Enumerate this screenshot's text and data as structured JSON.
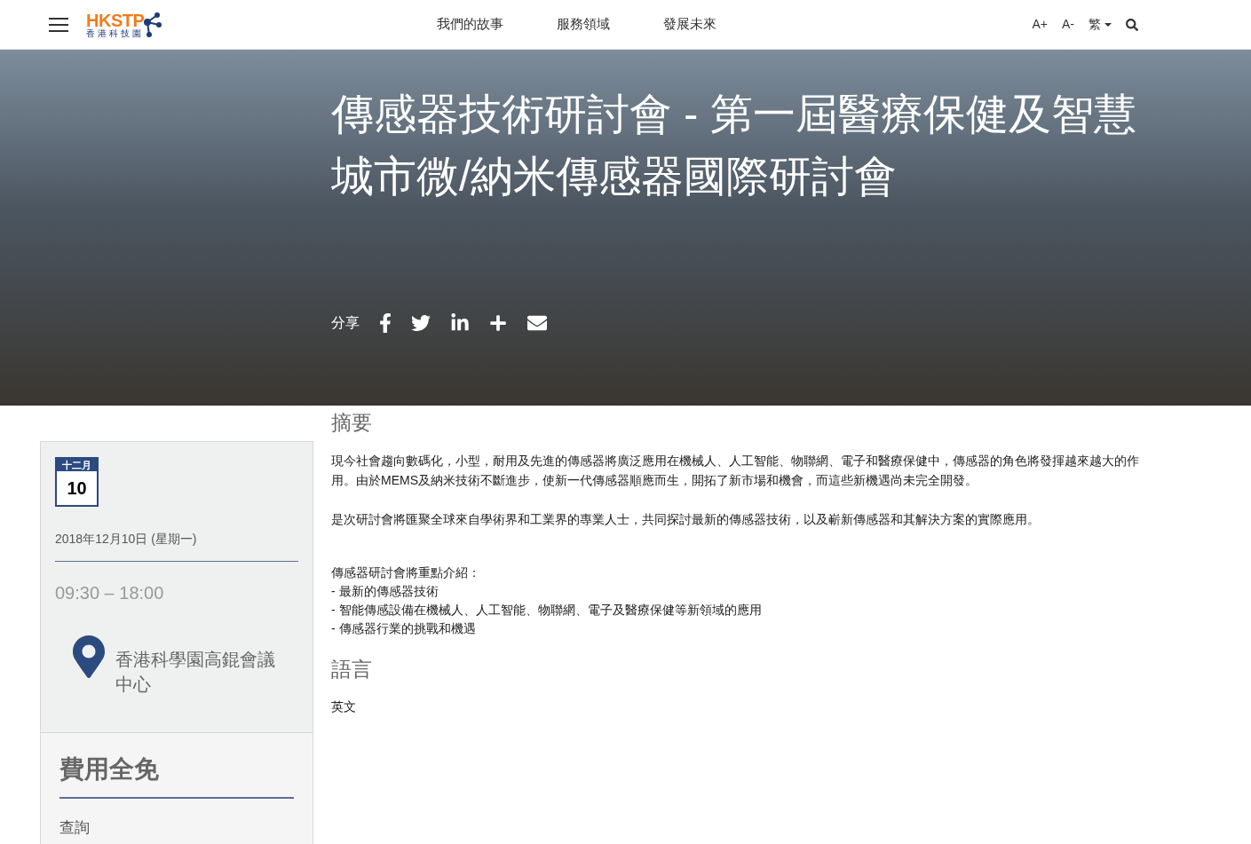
{
  "header": {
    "logo": {
      "text": "HKSTP",
      "subtext": "香港科技園"
    },
    "nav": [
      "我們的故事",
      "服務領域",
      "發展未來"
    ],
    "tools": {
      "font_up": "A+",
      "font_down": "A-",
      "language": "繁"
    }
  },
  "hero": {
    "title": "傳感器技術研討會 - 第一屆醫療保健及智慧城市微/納米傳感器國際研討會",
    "share_label": "分享",
    "share_icons": [
      {
        "kind": "facebook"
      },
      {
        "kind": "twitter"
      },
      {
        "kind": "linkedin"
      },
      {
        "kind": "plus"
      },
      {
        "kind": "email"
      }
    ]
  },
  "event_card": {
    "month": "十二月",
    "day": "10",
    "date": "2018年12月10日 (星期一)",
    "time": "09:30 – 18:00",
    "venue": "香港科學園高錕會議中心"
  },
  "fee_card": {
    "fee": "費用全免",
    "enquiry": "查詢"
  },
  "sections": [
    {
      "heading": "摘要",
      "paragraphs": [
        "現今社會趨向數碼化，小型，耐用及先進的傳感器將廣泛應用在機械人、人工智能、物聯網、電子和醫療保健中，傳感器的角色將發揮越來越大的作用。由於MEMS及納米技術不斷進步，使新一代傳感器順應而生，開拓了新市場和機會，而這些新機遇尚未完全開發。",
        "是次研討會將匯聚全球來自學術界和工業界的專業人士，共同探討最新的傳感器技術，以及嶄新傳感器和其解決方案的實際應用。"
      ],
      "list_title": "傳感器研討會將重點介紹：",
      "list": [
        "- 最新的傳感器技術",
        "- 智能傳感設備在機械人、人工智能、物聯網、電子及醫療保健等新領域的應用",
        "- 傳感器行業的挑戰和機遇"
      ]
    },
    {
      "heading": "語言",
      "paragraphs": [
        "英文"
      ]
    }
  ]
}
